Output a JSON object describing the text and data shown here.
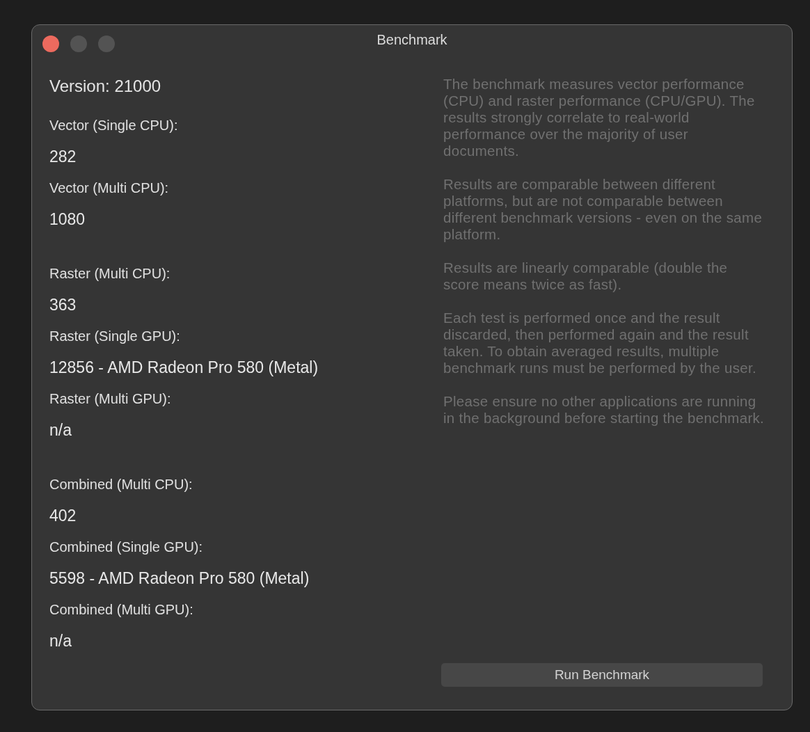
{
  "window": {
    "title": "Benchmark",
    "buttons": [
      {
        "color": "#ec6a5e"
      },
      {
        "color": "#535353"
      },
      {
        "color": "#535353"
      }
    ]
  },
  "version": "Version: 21000",
  "groups": [
    {
      "results": [
        {
          "label": "Vector (Single CPU):",
          "value": "282"
        },
        {
          "label": "Vector (Multi CPU):",
          "value": "1080"
        }
      ]
    },
    {
      "results": [
        {
          "label": "Raster (Multi CPU):",
          "value": "363"
        },
        {
          "label": "Raster (Single GPU):",
          "value": "12856 - AMD Radeon Pro 580 (Metal)"
        },
        {
          "label": "Raster (Multi GPU):",
          "value": "n/a"
        }
      ]
    },
    {
      "results": [
        {
          "label": "Combined (Multi CPU):",
          "value": "402"
        },
        {
          "label": "Combined (Single GPU):",
          "value": "5598 - AMD Radeon Pro 580 (Metal)"
        },
        {
          "label": "Combined (Multi GPU):",
          "value": "n/a"
        }
      ]
    }
  ],
  "description": [
    "The benchmark measures vector performance (CPU) and raster performance (CPU/GPU). The results strongly correlate to real-world performance over the majority of user documents.",
    "Results are comparable between different platforms, but are not comparable between different benchmark versions - even on the same platform.",
    "Results are linearly comparable (double the score means twice as fast).",
    "Each test is performed once and the result discarded, then performed again and the result taken. To obtain averaged results, multiple benchmark runs must be performed by the user.",
    "Please ensure no other applications are running in the background before starting the benchmark."
  ],
  "run_button": "Run Benchmark"
}
